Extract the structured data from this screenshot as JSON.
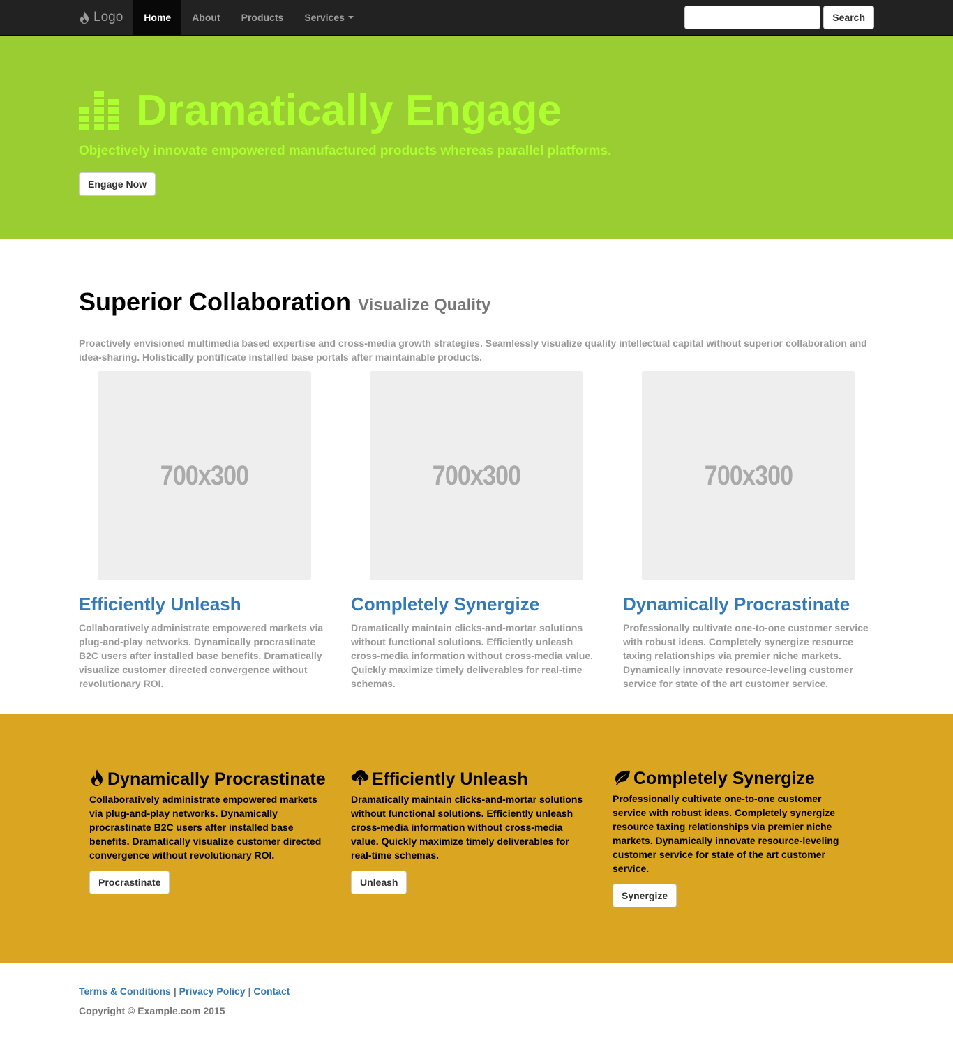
{
  "navbar": {
    "brand": "Logo",
    "items": [
      {
        "label": "Home"
      },
      {
        "label": "About"
      },
      {
        "label": "Products"
      },
      {
        "label": "Services"
      }
    ],
    "search_placeholder": "",
    "search_button": "Search"
  },
  "hero": {
    "title": "Dramatically Engage",
    "subtitle": "Objectively innovate empowered manufactured products whereas parallel platforms.",
    "button": "Engage Now",
    "color": "#adff2f",
    "background": "#9acd32"
  },
  "main": {
    "heading": "Superior Collaboration",
    "subheading": "Visualize Quality",
    "lead": "Proactively envisioned multimedia based expertise and cross-media growth strategies. Seamlessly visualize quality intellectual capital without superior collaboration and idea-sharing. Holistically pontificate installed base portals after maintainable products.",
    "columns": [
      {
        "image_label": "700x300",
        "title": "Efficiently Unleash",
        "text": "Collaboratively administrate empowered markets via plug-and-play networks. Dynamically procrastinate B2C users after installed base benefits. Dramatically visualize customer directed convergence without revolutionary ROI."
      },
      {
        "image_label": "700x300",
        "title": "Completely Synergize",
        "text": "Dramatically maintain clicks-and-mortar solutions without functional solutions. Efficiently unleash cross-media information without cross-media value. Quickly maximize timely deliverables for real-time schemas."
      },
      {
        "image_label": "700x300",
        "title": "Dynamically Procrastinate",
        "text": "Professionally cultivate one-to-one customer service with robust ideas. Completely synergize resource taxing relationships via premier niche markets. Dynamically innovate resource-leveling customer service for state of the art customer service."
      }
    ]
  },
  "features": {
    "background": "#daa520",
    "items": [
      {
        "icon": "fire-icon",
        "title": "Dynamically Procrastinate",
        "text": "Collaboratively administrate empowered markets via plug-and-play networks. Dynamically procrastinate B2C users after installed base benefits. Dramatically visualize customer directed convergence without revolutionary ROI.",
        "button": "Procrastinate"
      },
      {
        "icon": "cloud-upload-icon",
        "title": "Efficiently Unleash",
        "text": "Dramatically maintain clicks-and-mortar solutions without functional solutions. Efficiently unleash cross-media information without cross-media value. Quickly maximize timely deliverables for real-time schemas.",
        "button": "Unleash"
      },
      {
        "icon": "leaf-icon",
        "title": "Completely Synergize",
        "text": "Professionally cultivate one-to-one customer service with robust ideas. Completely synergize resource taxing relationships via premier niche markets. Dynamically innovate resource-leveling customer service for state of the art customer service.",
        "button": "Synergize"
      }
    ]
  },
  "footer": {
    "links": [
      {
        "label": "Terms & Conditions"
      },
      {
        "label": "Privacy Policy"
      },
      {
        "label": "Contact"
      }
    ],
    "separator": "|",
    "copyright": "Copyright © Example.com 2015"
  }
}
